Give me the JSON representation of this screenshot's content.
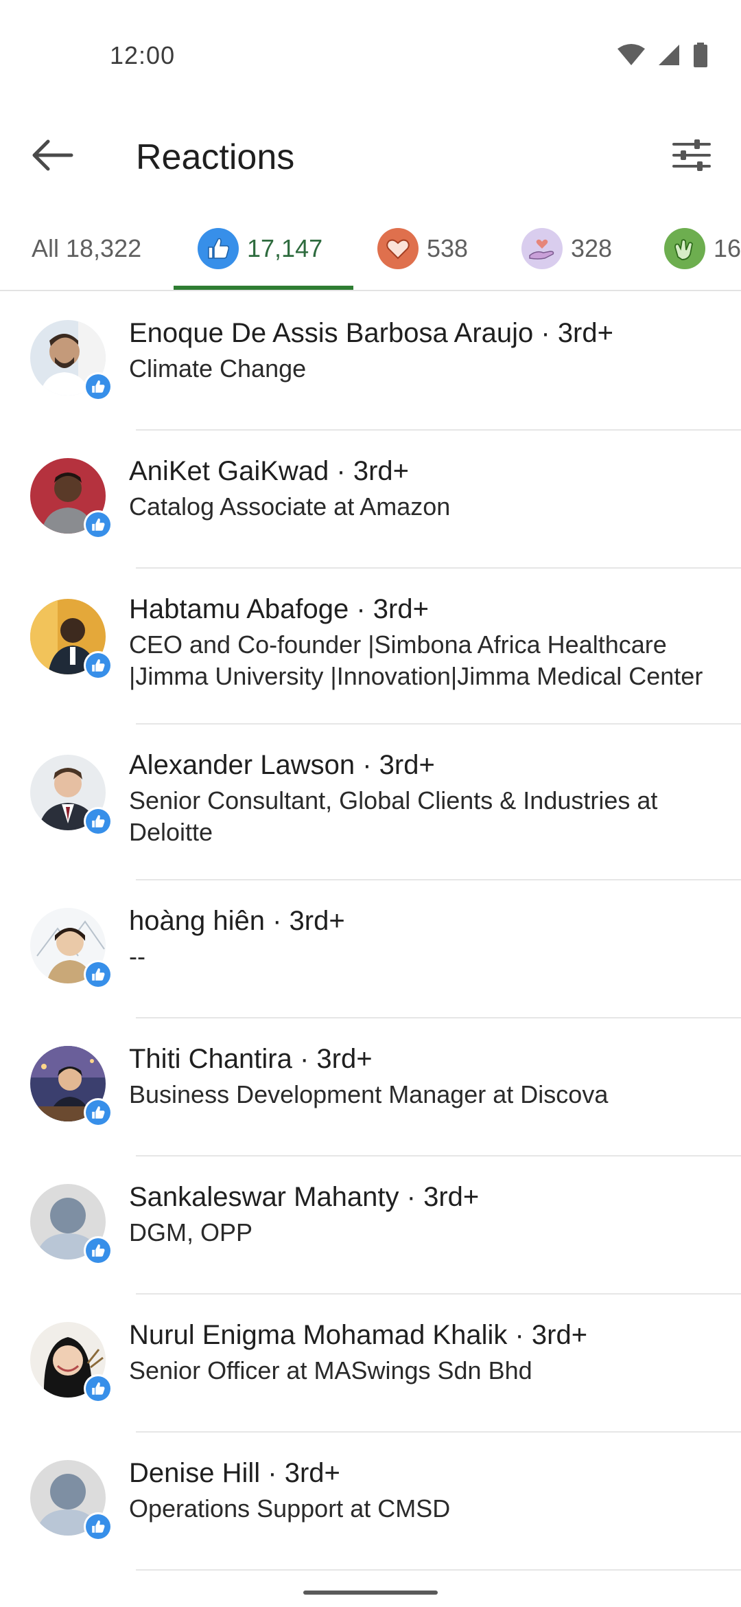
{
  "status_bar": {
    "time": "12:00"
  },
  "app_bar": {
    "title": "Reactions"
  },
  "tabs": [
    {
      "label": "All 18,322",
      "icon": "none",
      "active": false
    },
    {
      "label": "17,147",
      "icon": "like-icon",
      "active": true,
      "color": "#378fe9"
    },
    {
      "label": "538",
      "icon": "love-icon",
      "active": false,
      "color": "#df704d"
    },
    {
      "label": "328",
      "icon": "support-icon",
      "active": false,
      "color": "#c7b8e0"
    },
    {
      "label": "16",
      "icon": "celebrate-icon",
      "active": false,
      "color": "#6dae4f"
    }
  ],
  "reactors": [
    {
      "name": "Enoque De Assis Barbosa Araujo",
      "degree": " · 3rd+",
      "headline": "Climate Change",
      "avatar": "photo"
    },
    {
      "name": "AniKet GaiKwad",
      "degree": " · 3rd+",
      "headline": "Catalog Associate at Amazon",
      "avatar": "photo"
    },
    {
      "name": "Habtamu Abafoge",
      "degree": " · 3rd+",
      "headline": "CEO and Co-founder |Simbona Africa Healthcare |Jimma University |Innovation|Jimma Medical Center",
      "avatar": "photo"
    },
    {
      "name": "Alexander Lawson",
      "degree": " · 3rd+",
      "headline": "Senior Consultant, Global Clients & Industries at Deloitte",
      "avatar": "photo"
    },
    {
      "name": "hoàng hiên",
      "degree": " · 3rd+",
      "headline": "--",
      "avatar": "photo"
    },
    {
      "name": "Thiti Chantira",
      "degree": " · 3rd+",
      "headline": "Business Development Manager at Discova",
      "avatar": "photo"
    },
    {
      "name": "Sankaleswar Mahanty",
      "degree": " · 3rd+",
      "headline": "DGM, OPP",
      "avatar": "placeholder"
    },
    {
      "name": "Nurul Enigma Mohamad Khalik",
      "degree": " · 3rd+",
      "headline": "Senior Officer at MASwings Sdn Bhd",
      "avatar": "photo"
    },
    {
      "name": "Denise Hill",
      "degree": " · 3rd+",
      "headline": "Operations Support at CMSD",
      "avatar": "placeholder"
    }
  ],
  "colors": {
    "accent": "#2e7d32",
    "like_blue": "#378fe9"
  }
}
